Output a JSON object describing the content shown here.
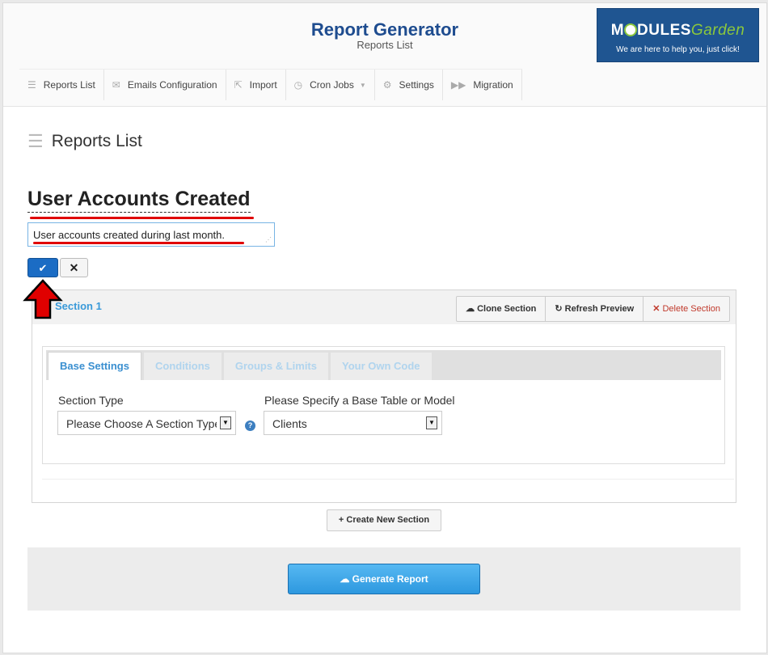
{
  "header": {
    "title": "Report Generator",
    "subtitle": "Reports List",
    "logo_part1": "M",
    "logo_part2": "DULES",
    "logo_part3": "Garden",
    "logo_tagline": "We are here to help you, just click!"
  },
  "nav": [
    {
      "label": "Reports List",
      "icon": "list-icon"
    },
    {
      "label": "Emails Configuration",
      "icon": "envelope-icon"
    },
    {
      "label": "Import",
      "icon": "import-icon"
    },
    {
      "label": "Cron Jobs",
      "icon": "clock-icon"
    },
    {
      "label": "Settings",
      "icon": "gears-icon"
    },
    {
      "label": "Migration",
      "icon": "forward-icon"
    }
  ],
  "page": {
    "heading": "Reports List"
  },
  "report": {
    "title": "User Accounts Created",
    "description": "User accounts created during last month."
  },
  "section": {
    "title": "Section 1",
    "clone_label": "Clone Section",
    "refresh_label": "Refresh Preview",
    "delete_label": "Delete Section",
    "tabs": [
      "Base Settings",
      "Conditions",
      "Groups & Limits",
      "Your Own Code"
    ],
    "section_type_label": "Section Type",
    "section_type_value": "Please Choose A Section Type",
    "base_table_label": "Please Specify a Base Table or Model",
    "base_table_value": "Clients"
  },
  "actions": {
    "create_new_section": "Create New Section",
    "generate_report": "Generate Report"
  },
  "colors": {
    "accent": "#1e4c8f",
    "link": "#3a9ad9",
    "primary_button": "#2d98df",
    "highlight": "#e00000"
  }
}
